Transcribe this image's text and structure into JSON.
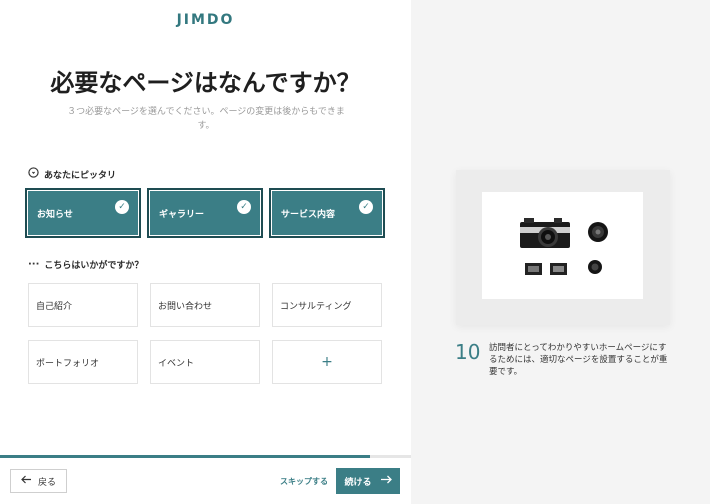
{
  "logo": "JIMDO",
  "title": "必要なページはなんですか？",
  "subtitle": "３つ必要なページを選んでください。ページの変更は後からもできます。",
  "recommended": {
    "label": "あなたにピッタリ",
    "icon": "heart-face-icon",
    "items": [
      {
        "label": "お知らせ",
        "selected": true
      },
      {
        "label": "ギャラリー",
        "selected": true
      },
      {
        "label": "サービス内容",
        "selected": true
      }
    ]
  },
  "others": {
    "label": "こちらはいかがですか？",
    "icon": "dots-icon",
    "items": [
      {
        "label": "自己紹介"
      },
      {
        "label": "お問い合わせ"
      },
      {
        "label": "コンサルティング"
      },
      {
        "label": "ポートフォリオ"
      },
      {
        "label": "イベント"
      },
      {
        "label": "+"
      }
    ]
  },
  "progress": 0.9,
  "footer": {
    "back_label": "戻る",
    "skip_label": "スキップする",
    "next_label": "続ける"
  },
  "tip": {
    "number": "10",
    "text": "訪問者にとってわかりやすいホームページにするためには、適切なページを設置することが重要です。"
  },
  "colors": {
    "accent": "#3b7e86",
    "accent_dark": "#1e4c52",
    "panel": "#f4f4f4"
  }
}
